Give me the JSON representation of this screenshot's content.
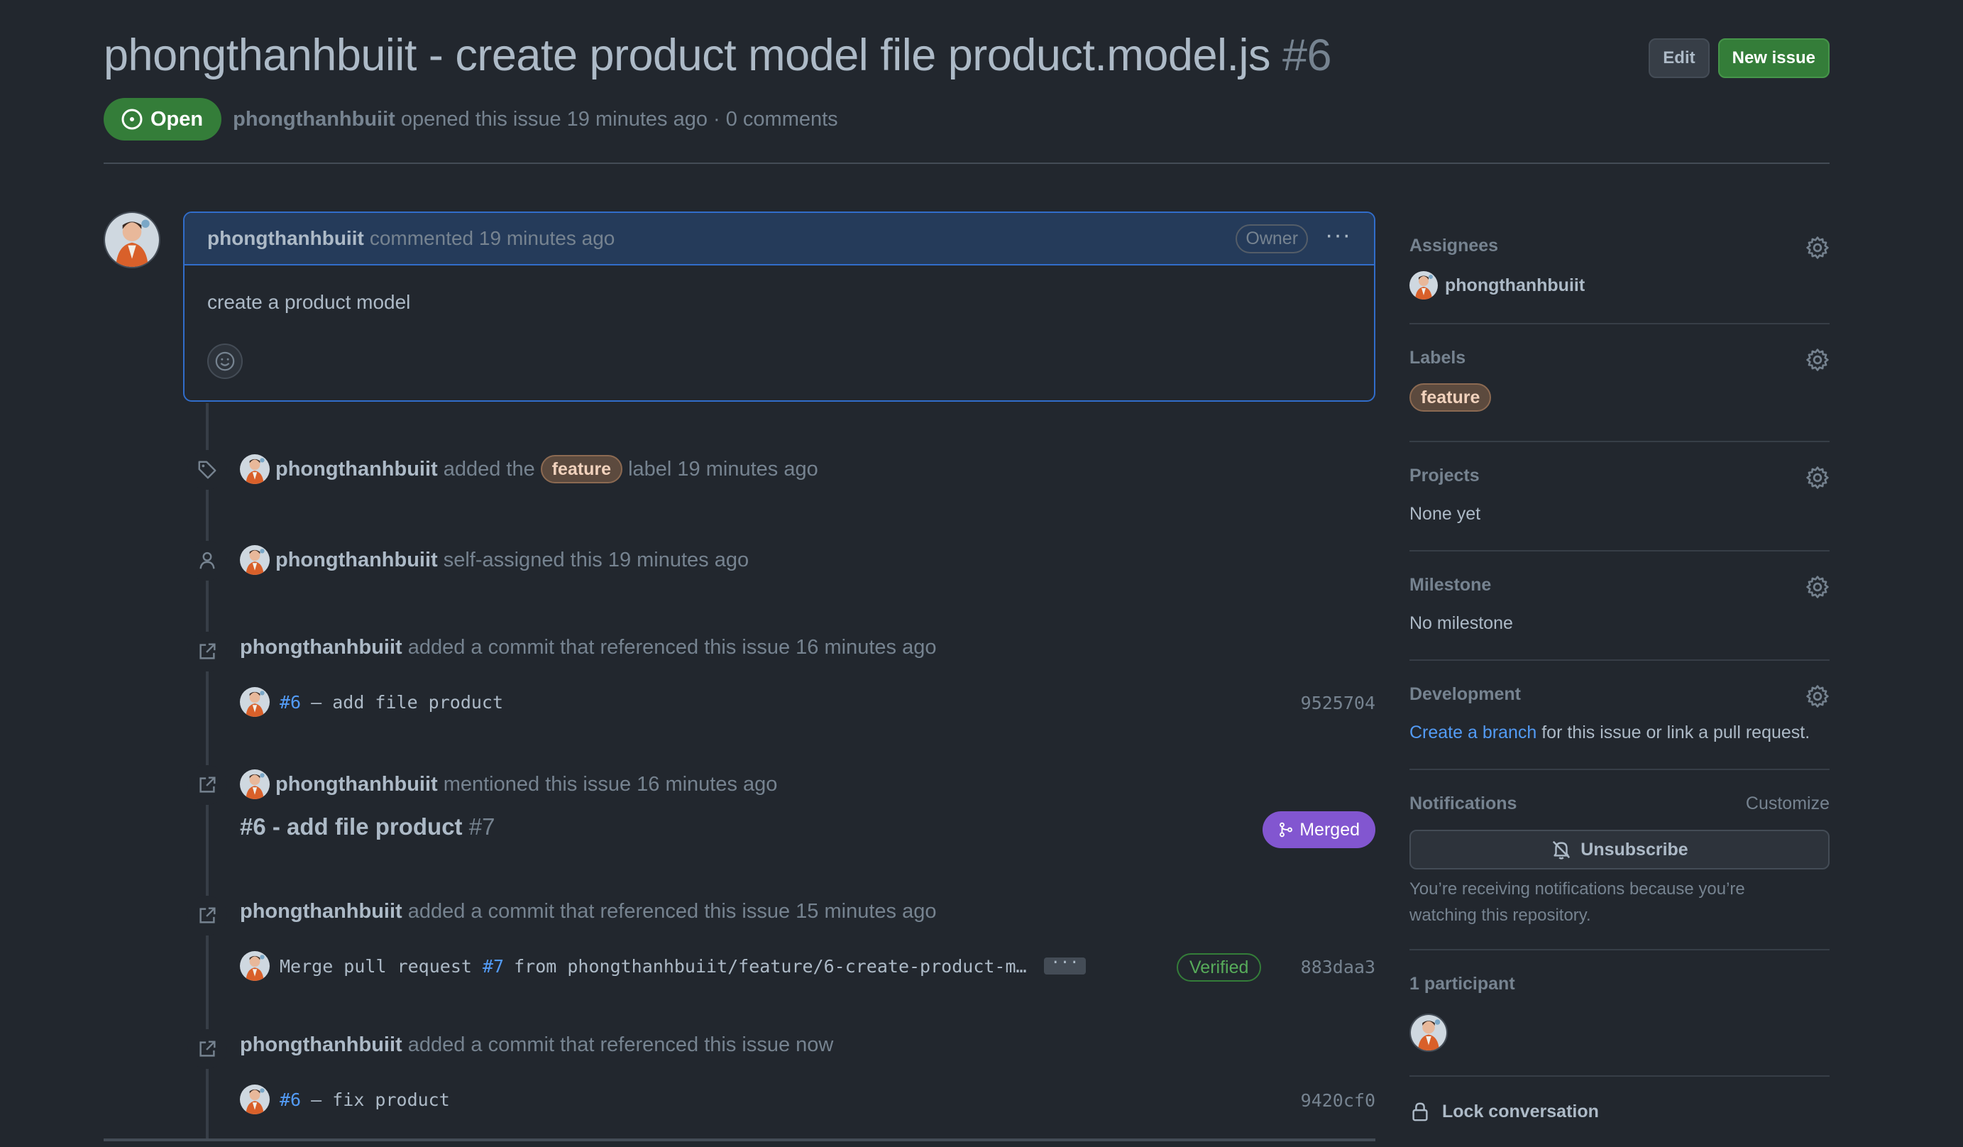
{
  "issue": {
    "title": "phongthanhbuiit - create product model file product.model.js",
    "number": "#6",
    "state": "Open",
    "author": "phongthanhbuiit",
    "opened_text": "opened this issue 19 minutes ago · 0 comments"
  },
  "header_buttons": {
    "edit": "Edit",
    "new_issue": "New issue"
  },
  "comment": {
    "author": "phongthanhbuiit",
    "meta": "commented 19 minutes ago",
    "badge": "Owner",
    "menu": "···",
    "body": "create a product model"
  },
  "timeline": {
    "label_event": {
      "user": "phongthanhbuiit",
      "pre": "added the",
      "label": "feature",
      "post": "label 19 minutes ago"
    },
    "assign_event": {
      "user": "phongthanhbuiit",
      "text": "self-assigned this 19 minutes ago"
    },
    "commit_event_1": {
      "user": "phongthanhbuiit",
      "text": "added a commit that referenced this issue 16 minutes ago",
      "commit_ref": "#6",
      "commit_msg": "– add file product",
      "sha": "9525704"
    },
    "mention_event": {
      "user": "phongthanhbuiit",
      "text": "mentioned this issue 16 minutes ago",
      "pr_title": "#6 - add file product",
      "pr_number": "#7",
      "pr_state": "Merged"
    },
    "commit_event_2": {
      "user": "phongthanhbuiit",
      "text": "added a commit that referenced this issue 15 minutes ago",
      "msg_pre": "Merge pull request",
      "msg_ref": "#7",
      "msg_post": "from phongthanhbuiit/feature/6-create-product-m…",
      "ellipsis": "···",
      "verified": "Verified",
      "sha": "883daa3"
    },
    "commit_event_3": {
      "user": "phongthanhbuiit",
      "text": "added a commit that referenced this issue now",
      "commit_ref": "#6",
      "commit_msg": "– fix product",
      "sha": "9420cf0"
    }
  },
  "sidebar": {
    "assignees": {
      "heading": "Assignees",
      "value": "phongthanhbuiit"
    },
    "labels": {
      "heading": "Labels",
      "value": "feature"
    },
    "projects": {
      "heading": "Projects",
      "value": "None yet"
    },
    "milestone": {
      "heading": "Milestone",
      "value": "No milestone"
    },
    "development": {
      "heading": "Development",
      "link": "Create a branch",
      "text": "for this issue or link a pull request."
    },
    "notifications": {
      "heading": "Notifications",
      "customize": "Customize",
      "button": "Unsubscribe",
      "note_1": "You’re receiving notifications because you’re",
      "note_2": "watching this repository."
    },
    "participants": {
      "heading": "1 participant"
    },
    "lock": {
      "label": "Lock conversation"
    }
  },
  "colors": {
    "bg": "#22272e",
    "open_green": "#347d39",
    "merged_purple": "#8256d0",
    "link_blue": "#539bf5",
    "label_bg": "#5c4a3e"
  }
}
